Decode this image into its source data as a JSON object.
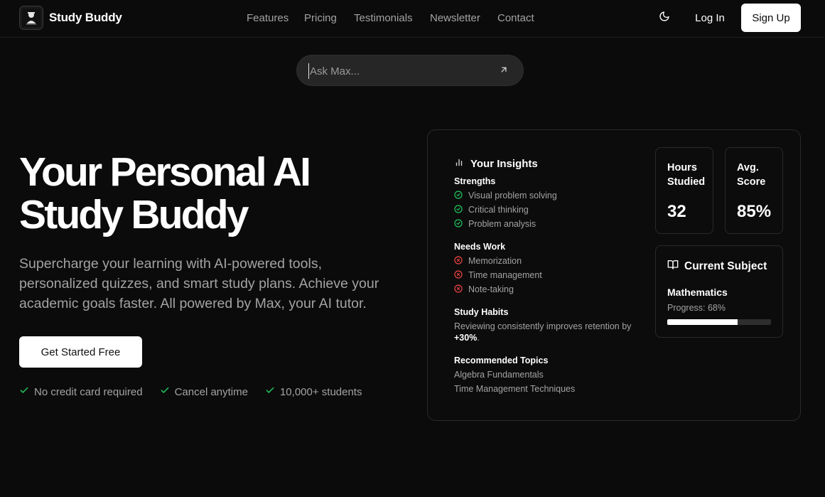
{
  "nav": {
    "brand": "Study Buddy",
    "links": [
      "Features",
      "Pricing",
      "Testimonials",
      "Newsletter",
      "Contact"
    ],
    "login": "Log In",
    "signup": "Sign Up",
    "theme_icon": "moon-icon"
  },
  "ask": {
    "placeholder": "Ask Max...",
    "send_icon": "arrow-up-right-icon"
  },
  "hero": {
    "title_line1": "Your Personal AI",
    "title_line2": "Study Buddy",
    "subtitle": "Supercharge your learning with AI-powered tools, personalized quizzes, and smart study plans. Achieve your academic goals faster. All powered by Max, your AI tutor.",
    "cta": "Get Started Free",
    "perks": [
      "No credit card required",
      "Cancel anytime",
      "10,000+ students"
    ]
  },
  "insights": {
    "title": "Your Insights",
    "strengths_title": "Strengths",
    "strengths": [
      "Visual problem solving",
      "Critical thinking",
      "Problem analysis"
    ],
    "needs_title": "Needs Work",
    "needs": [
      "Memorization",
      "Time management",
      "Note-taking"
    ],
    "habits_title": "Study Habits",
    "habits_text": "Reviewing consistently improves retention by",
    "habits_value": "+30%",
    "habits_end": ".",
    "topics_title": "Recommended Topics",
    "topics": [
      "Algebra Fundamentals",
      "Time Management Techniques"
    ]
  },
  "stats": {
    "hours_label_1": "Hours",
    "hours_label_2": "Studied",
    "hours_value": "32",
    "score_label_1": "Avg.",
    "score_label_2": "Score",
    "score_value": "85%"
  },
  "subject": {
    "title": "Current Subject",
    "name": "Mathematics",
    "progress_text": "Progress: 68%",
    "progress": 0.68
  },
  "colors": {
    "check": "#22c55e",
    "cross": "#ef4444",
    "background": "#0b0b0b"
  }
}
